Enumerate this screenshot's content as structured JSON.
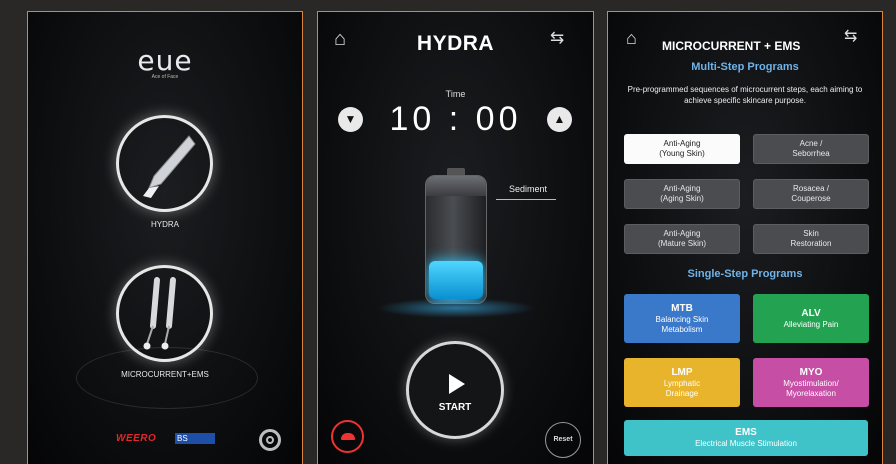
{
  "panel1": {
    "logo": "eue",
    "logo_sub": "Ace of Face",
    "modes": [
      "HYDRA",
      "MICROCURRENT+EMS"
    ],
    "brand": "WEERO",
    "brand2": "BS"
  },
  "panel2": {
    "title": "HYDRA",
    "time_label": "Time",
    "time_value": "10 : 00",
    "sediment_label": "Sediment",
    "start_label": "START",
    "reset_label": "Reset",
    "battery_level": 0.3
  },
  "panel3": {
    "title": "MICROCURRENT + EMS",
    "multi_heading": "Multi-Step Programs",
    "multi_desc": "Pre-programmed sequences of microcurrent steps, each aiming to achieve specific skincare purpose.",
    "multi_programs": [
      {
        "line1": "Anti-Aging",
        "line2": "(Young Skin)",
        "selected": true
      },
      {
        "line1": "Acne /",
        "line2": "Seborrhea",
        "selected": false
      },
      {
        "line1": "Anti-Aging",
        "line2": "(Aging Skin)",
        "selected": false
      },
      {
        "line1": "Rosacea /",
        "line2": "Couperose",
        "selected": false
      },
      {
        "line1": "Anti-Aging",
        "line2": "(Mature Skin)",
        "selected": false
      },
      {
        "line1": "Skin",
        "line2": "Restoration",
        "selected": false
      }
    ],
    "single_heading": "Single-Step Programs",
    "single_programs": [
      {
        "code": "MTB",
        "line1": "Balancing Skin",
        "line2": "Metabolism",
        "color": "#3a78c9"
      },
      {
        "code": "ALV",
        "line1": "Alleviating Pain",
        "line2": "",
        "color": "#23a351"
      },
      {
        "code": "LMP",
        "line1": "Lymphatic",
        "line2": "Drainage",
        "color": "#e8b42c"
      },
      {
        "code": "MYO",
        "line1": "Myostimulation/",
        "line2": "Myorelaxation",
        "color": "#c64ea5"
      },
      {
        "code": "EMS",
        "line1": "Electrical Muscle Stimulation",
        "line2": "",
        "color": "#3fc3c8"
      }
    ]
  }
}
